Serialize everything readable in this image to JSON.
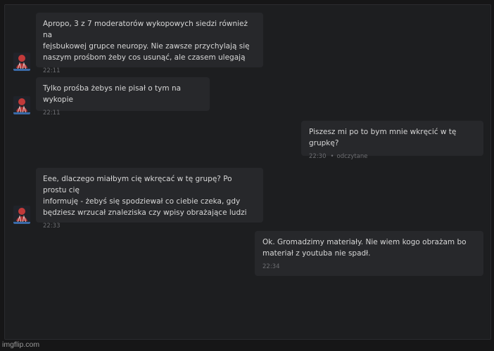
{
  "messages": [
    {
      "direction": "incoming",
      "text": "Apropo, 3 z 7 moderatorów wykopowych siedzi również na\nfejsbukowej grupce neuropy. Nie zawsze przychylają się\nnaszym prośbom żeby cos usunąć, ale czasem ulegają",
      "time": "22:11"
    },
    {
      "direction": "incoming",
      "text": "Tylko prośba żebys nie pisał o tym na wykopie",
      "time": "22:11"
    },
    {
      "direction": "outgoing",
      "text": "Piszesz mi po to bym mnie wkręcić w tę grupkę?",
      "time": "22:30",
      "status": "odczytane"
    },
    {
      "direction": "incoming",
      "text": "Eee, dlaczego miałbym cię wkręcać w tę grupę? Po prostu cię\ninformuję - żebyś się spodziewał co ciebie czeka, gdy\nbędziesz wrzucał znaleziska czy wpisy obrażające ludzi",
      "time": "22:33"
    },
    {
      "direction": "outgoing",
      "text": "Ok. Gromadzimy materiały. Nie wiem kogo obrażam bo\nmateriał z youtuba nie spadł.",
      "time": "22:34"
    }
  ],
  "watermark": "imgflip.com",
  "colors": {
    "background": "#1d1e20",
    "bubble": "#27282b",
    "text": "#d7d7d7",
    "muted": "#6c6d71",
    "avatar_accent": "#c23a3a"
  },
  "icons": {
    "avatar": "user-avatar-icon"
  }
}
